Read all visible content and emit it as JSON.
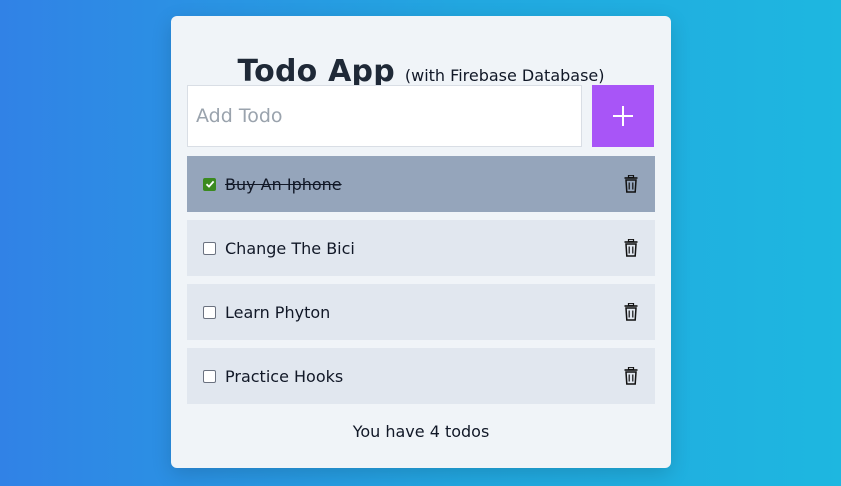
{
  "header": {
    "title": "Todo App",
    "subtitle": "(with Firebase Database)"
  },
  "add_form": {
    "placeholder": "Add Todo",
    "value": "",
    "button_icon": "plus-icon"
  },
  "todos": [
    {
      "label": "Buy An Iphone",
      "completed": true,
      "delete_icon": "trash-icon"
    },
    {
      "label": "Change The Bici",
      "completed": false,
      "delete_icon": "trash-icon"
    },
    {
      "label": "Learn Phyton",
      "completed": false,
      "delete_icon": "trash-icon"
    },
    {
      "label": "Practice Hooks",
      "completed": false,
      "delete_icon": "trash-icon"
    }
  ],
  "footer": {
    "count_text": "You have 4 todos"
  },
  "colors": {
    "accent": "#a855f7",
    "completed_row": "#95a5bb",
    "row": "#e1e7ef",
    "checked": "#3b8a1f"
  }
}
